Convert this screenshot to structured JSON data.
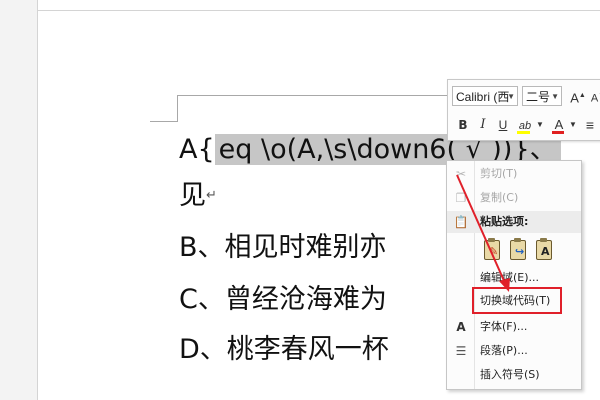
{
  "document": {
    "lines": [
      {
        "prefix": "A{",
        "field": "eq \\o(A,\\s\\down6( √ ))}、",
        "suffix": ""
      },
      {
        "text": "见",
        "para_mark": "↵"
      },
      {
        "text": "B、相见时难别亦"
      },
      {
        "text": "C、曾经沧海难为"
      },
      {
        "text": "D、桃李春风一杯"
      }
    ]
  },
  "mini_toolbar": {
    "font_name": "Calibri (西",
    "font_size": "二号",
    "grow_font": "A",
    "shrink_font": "A",
    "bold": "B",
    "italic": "I",
    "underline": "U",
    "highlight": "ab",
    "font_color": "A",
    "more": "≡",
    "highlight_color": "#ffff00",
    "font_color_value": "#e02020"
  },
  "context_menu": {
    "items": [
      {
        "label": "剪切(T)",
        "icon": "scissors-icon",
        "disabled": true
      },
      {
        "label": "复制(C)",
        "icon": "copy-icon",
        "disabled": true
      },
      {
        "label": "粘贴选项:",
        "icon": "paste-icon",
        "header": true
      },
      {
        "label": "编辑域(E)...",
        "icon": ""
      },
      {
        "label": "切换域代码(T)",
        "icon": "",
        "highlighted": true
      },
      {
        "label": "字体(F)...",
        "icon": "font-icon"
      },
      {
        "label": "段落(P)...",
        "icon": "paragraph-icon"
      },
      {
        "label": "插入符号(S)",
        "icon": ""
      }
    ],
    "paste_options": [
      "keep-source-formatting",
      "merge-formatting",
      "keep-text-only"
    ],
    "paste_text_only_letter": "A"
  },
  "colors": {
    "annotation_red": "#e0202a",
    "field_highlight": "#c6c6c6"
  }
}
